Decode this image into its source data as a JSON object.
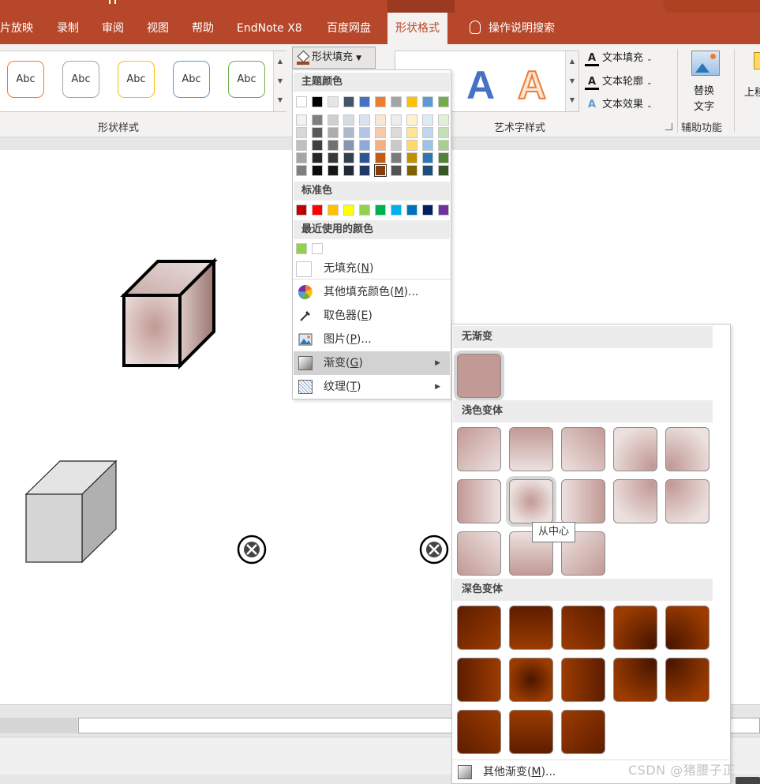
{
  "titlebar": {
    "left_fragment": "",
    "context_fragment": ""
  },
  "tabs": [
    {
      "label": "片放映"
    },
    {
      "label": "录制"
    },
    {
      "label": "审阅"
    },
    {
      "label": "视图"
    },
    {
      "label": "帮助"
    },
    {
      "label": "EndNote X8"
    },
    {
      "label": "百度网盘"
    },
    {
      "label": "形状格式"
    },
    {
      "label": "操作说明搜索"
    }
  ],
  "ribbon": {
    "shape_styles_label": "形状样式",
    "abc_label": "Abc",
    "abc_border_colors": [
      "#ed7d31",
      "#a5a5a5",
      "#ffc000",
      "#5b9bd5",
      "#70ad47"
    ],
    "fill_button": "形状填充",
    "wordart_label": "艺术字样式",
    "wordart_A": "A",
    "text_fill": "文本填充",
    "text_outline": "文本轮廓",
    "text_effects": "文本效果",
    "alt_text_line1": "替换",
    "alt_text_line2": "文字",
    "accessibility_label": "辅助功能",
    "next_group_fragment": "上移"
  },
  "fill_menu": {
    "theme_colors_head": "主题颜色",
    "theme_top": [
      "#ffffff",
      "#000000",
      "#e7e6e6",
      "#44546a",
      "#4472c4",
      "#ed7d31",
      "#a5a5a5",
      "#ffc000",
      "#5b9bd5",
      "#70ad47"
    ],
    "theme_shades": [
      [
        "#f2f2f2",
        "#7f7f7f",
        "#d0cece",
        "#d6dce4",
        "#d9e2f3",
        "#fbe5d5",
        "#ededed",
        "#fff2cc",
        "#deebf6",
        "#e2efd9"
      ],
      [
        "#d8d8d8",
        "#595959",
        "#aeabab",
        "#adb9ca",
        "#b4c6e7",
        "#f7caac",
        "#dbdbdb",
        "#fee599",
        "#bdd7ee",
        "#c5e0b3"
      ],
      [
        "#bfbfbf",
        "#3f3f3f",
        "#757070",
        "#8496b0",
        "#8eaadb",
        "#f4b083",
        "#c9c9c9",
        "#ffd965",
        "#9cc3e5",
        "#a8d08d"
      ],
      [
        "#a5a5a5",
        "#262626",
        "#3a3838",
        "#323f4f",
        "#2f5496",
        "#c55a11",
        "#7b7b7b",
        "#bf8f00",
        "#2e75b5",
        "#538135"
      ],
      [
        "#7f7f7f",
        "#0c0c0c",
        "#171616",
        "#222a35",
        "#1f3864",
        "#843c0b",
        "#525252",
        "#7f6000",
        "#1e4d78",
        "#375623"
      ]
    ],
    "standard_head": "标准色",
    "standard": [
      "#c00000",
      "#ff0000",
      "#ffc000",
      "#ffff00",
      "#92d050",
      "#00b050",
      "#00b0f0",
      "#0070c0",
      "#002060",
      "#7030a0"
    ],
    "recent_head": "最近使用的颜色",
    "recent": [
      "#92d050",
      "#ffffff"
    ],
    "no_fill": "无填充(N)",
    "more_colors": "其他填充颜色(M)...",
    "eyedropper": "取色器(E)",
    "picture": "图片(P)...",
    "gradient": "渐变(G)",
    "texture": "纹理(T)"
  },
  "grad_menu": {
    "none_head": "无渐变",
    "none_color": "#c29994",
    "light_head": "浅色变体",
    "dark_head": "深色变体",
    "tooltip": "从中心",
    "more": "其他渐变(M)..."
  },
  "watermark": "CSDN @猪腰子正"
}
